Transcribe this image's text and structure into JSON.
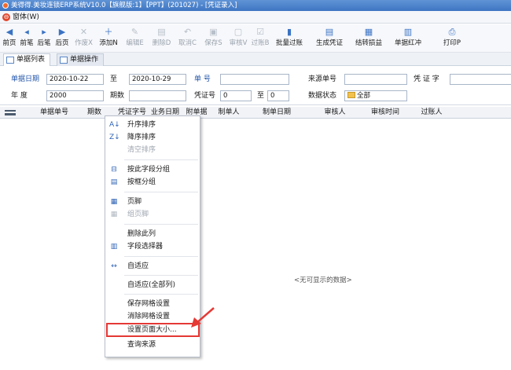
{
  "window": {
    "title": "美得得.美妆连锁ERP系统V10.0【旗舰版:1】【PPT】(201027) - [凭证录入]"
  },
  "menubar": {
    "items": [
      {
        "label": "窗体(W)"
      }
    ]
  },
  "toolbar": {
    "buttons": [
      {
        "label": "前页",
        "icon": "first-icon",
        "glyph": "◀",
        "enabled": true
      },
      {
        "label": "前笔",
        "icon": "prev-icon",
        "glyph": "◂",
        "enabled": true
      },
      {
        "label": "后笔",
        "icon": "next-icon",
        "glyph": "▸",
        "enabled": true
      },
      {
        "label": "后页",
        "icon": "last-icon",
        "glyph": "▶",
        "enabled": true
      },
      {
        "label": "作废X",
        "icon": "void-icon",
        "glyph": "✕",
        "enabled": false
      },
      {
        "label": "添加N",
        "icon": "add-icon",
        "glyph": "＋",
        "enabled": true
      },
      {
        "label": "编辑E",
        "icon": "edit-icon",
        "glyph": "✎",
        "enabled": false
      },
      {
        "label": "删除D",
        "icon": "delete-icon",
        "glyph": "▤",
        "enabled": false
      },
      {
        "label": "取消C",
        "icon": "undo-icon",
        "glyph": "↶",
        "enabled": false
      },
      {
        "label": "保存S",
        "icon": "save-icon",
        "glyph": "▣",
        "enabled": false
      },
      {
        "label": "审核V",
        "icon": "audit-icon",
        "glyph": "▢",
        "enabled": false
      },
      {
        "label": "过账B",
        "icon": "post-icon",
        "glyph": "☑",
        "enabled": false
      },
      {
        "label": "批量过账",
        "icon": "batch-post-icon",
        "glyph": "▮",
        "enabled": true
      },
      {
        "label": "生成凭证",
        "icon": "voucher-icon",
        "glyph": "▤",
        "enabled": true
      },
      {
        "label": "结转损益",
        "icon": "carry-forward-icon",
        "glyph": "▦",
        "enabled": true
      },
      {
        "label": "单据红冲",
        "icon": "red-reverse-icon",
        "glyph": "▥",
        "enabled": true
      },
      {
        "label": "打印P",
        "icon": "print-icon",
        "glyph": "⎙",
        "enabled": true
      }
    ]
  },
  "tabs": [
    {
      "label": "单据列表",
      "active": true
    },
    {
      "label": "单据操作",
      "active": false
    }
  ],
  "filters": {
    "date_label": "单据日期",
    "date_from": "2020-10-22",
    "to_label": "至",
    "date_to": "2020-10-29",
    "doc_no_label": "单  号",
    "doc_no": "",
    "source_no_label": "来源单号",
    "source_no": "",
    "voucher_word_label": "凭 证 字",
    "voucher_word": "",
    "year_label": "年    度",
    "year": "2000",
    "period_label": "期数",
    "period": "",
    "voucher_no_label": "凭证号",
    "voucher_no_from": "0",
    "voucher_no_to_label": "至",
    "voucher_no_to": "0",
    "status_label": "数据状态",
    "status_value": "全部"
  },
  "grid": {
    "columns": [
      "单据单号",
      "期数",
      "凭证字号",
      "业务日期",
      "附单据",
      "制单人",
      "制单日期",
      "审核人",
      "审核时间",
      "过账人"
    ],
    "empty_text": "<无可显示的数据>"
  },
  "context_menu": {
    "items": [
      {
        "label": "升序排序",
        "icon": "sort-asc-icon",
        "glyph": "A↓",
        "enabled": true
      },
      {
        "label": "降序排序",
        "icon": "sort-desc-icon",
        "glyph": "Z↓",
        "enabled": true
      },
      {
        "label": "清空排序",
        "icon": "",
        "glyph": "",
        "enabled": false
      },
      {
        "label": "按此字段分组",
        "icon": "group-by-field-icon",
        "glyph": "⊟",
        "enabled": true
      },
      {
        "label": "按框分组",
        "icon": "group-box-icon",
        "glyph": "▤",
        "enabled": true
      },
      {
        "label": "页脚",
        "icon": "footer-icon",
        "glyph": "▦",
        "enabled": true
      },
      {
        "label": "组页脚",
        "icon": "group-footer-icon",
        "glyph": "▦",
        "enabled": false
      },
      {
        "label": "删除此列",
        "icon": "",
        "glyph": "",
        "enabled": true
      },
      {
        "label": "字段选择器",
        "icon": "field-chooser-icon",
        "glyph": "▥",
        "enabled": true
      },
      {
        "label": "自适应",
        "icon": "best-fit-icon",
        "glyph": "↔",
        "enabled": true
      },
      {
        "label": "自适应(全部列)",
        "icon": "",
        "glyph": "",
        "enabled": true
      },
      {
        "label": "保存网格设置",
        "icon": "",
        "glyph": "",
        "enabled": true
      },
      {
        "label": "消除网格设置",
        "icon": "",
        "glyph": "",
        "enabled": true
      },
      {
        "label": "设置页面大小...",
        "icon": "",
        "glyph": "",
        "enabled": true,
        "highlight": true
      },
      {
        "label": "查询来源",
        "icon": "",
        "glyph": "",
        "enabled": true
      }
    ]
  },
  "colors": {
    "title_bg": "#4a80c8",
    "highlight_border": "#e53935",
    "label_blue": "#2255aa"
  }
}
